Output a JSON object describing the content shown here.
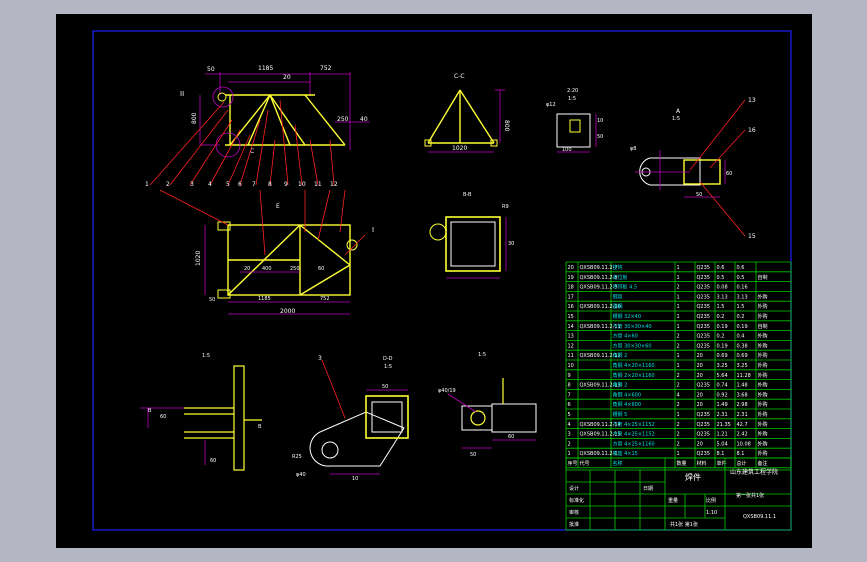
{
  "colors": {
    "background": "#b4b7c3",
    "sheet": "#000000",
    "frame": "#1b1bd6",
    "part": "#ffff33",
    "dim": "#c000c0",
    "leader": "#ff2020",
    "table": "#00cc00",
    "text": "#ffffff",
    "cyan": "#00e0e0"
  },
  "views": {
    "front": {
      "top_dims": [
        "50",
        "1185",
        "752"
      ],
      "mid_dims": [
        "20",
        "20"
      ],
      "left_dim": "800",
      "right_dims": [
        "250",
        "40"
      ],
      "section_mark": "C",
      "callout": "II",
      "leader_numbers": [
        "1",
        "2",
        "3",
        "4",
        "5",
        "6",
        "7",
        "8",
        "9",
        "10",
        "11",
        "12"
      ]
    },
    "section_cc": {
      "title": "C-C",
      "height_dim": "800",
      "base_dim": "1020"
    },
    "detail_small": {
      "scale_top": "2:20",
      "scale_bot": "1:5",
      "dim_a": "φ12",
      "dim_b": "100",
      "dim_c": "10",
      "dim_d": "50"
    },
    "detail_a": {
      "title": "A",
      "scale": "1:5",
      "dims": [
        "φ8",
        "50",
        "60"
      ],
      "leader_numbers": [
        "13",
        "16",
        "15"
      ]
    },
    "plan": {
      "mark": "E",
      "dims_inner": [
        "20",
        "400",
        "250",
        "60"
      ],
      "left_dim": "1020",
      "bottom_dims": [
        "50",
        "1185",
        "752"
      ],
      "total": "2000",
      "callout": "I"
    },
    "section_bb": {
      "title": "B-B",
      "dims": [
        "R9",
        "30"
      ]
    },
    "section_a": {
      "title": "1:5",
      "labels": [
        "B",
        "B"
      ],
      "dims": [
        "60",
        "60"
      ]
    },
    "section_dd": {
      "title": "D-D",
      "scale": "1:5",
      "leader": "3",
      "dims": [
        "50",
        "φ40",
        "R25",
        "10"
      ]
    },
    "detail_b": {
      "title": "1:5",
      "dims": [
        "φ40/19",
        "50",
        "60"
      ]
    }
  },
  "bom": {
    "rows": [
      [
        "20",
        "QXSB09.11.2-7",
        "挂钩",
        "1",
        "Q235",
        "0.6",
        "0.6",
        ""
      ],
      [
        "19",
        "QXSB09.11.2-8",
        "定位板",
        "1",
        "Q235",
        "0.5",
        "0.5",
        "自制"
      ],
      [
        "18",
        "QXSB09.11.2-9",
        "吊耳板 4.5",
        "2",
        "Q235",
        "0.08",
        "0.16",
        ""
      ],
      [
        "17",
        "",
        "钢管",
        "1",
        "Q235",
        "3.13",
        "3.13",
        "外购"
      ],
      [
        "16",
        "QXSB09.11.2-10",
        "圆钢",
        "1",
        "Q235",
        "1.5",
        "1.5",
        "外购"
      ],
      [
        "15",
        "",
        "槽钢 32×40",
        "1",
        "Q235",
        "0.2",
        "0.2",
        "外购"
      ],
      [
        "14",
        "QXSB09.11.2-11",
        "方管 30×30×40",
        "1",
        "Q235",
        "0.19",
        "0.19",
        "自制"
      ],
      [
        "13",
        "",
        "方管 4×60",
        "2",
        "Q235",
        "0.2",
        "0.4",
        "外购"
      ],
      [
        "12",
        "",
        "方管 30×30×60",
        "2",
        "Q235",
        "0.19",
        "0.38",
        "外购"
      ],
      [
        "11",
        "QXSB09.11.2-12",
        "角钢 2",
        "1",
        "20",
        "0.69",
        "0.69",
        "外购"
      ],
      [
        "10",
        "",
        "角钢 4×20×1160",
        "1",
        "20",
        "3.25",
        "3.25",
        "外购"
      ],
      [
        "9",
        "",
        "角钢 2×20×1160",
        "2",
        "20",
        "5.64",
        "11.28",
        "外购"
      ],
      [
        "8",
        "QXSB09.11.2-13",
        "角钢 2",
        "2",
        "Q235",
        "0.74",
        "1.48",
        "外购"
      ],
      [
        "7",
        "",
        "角钢 4×600",
        "4",
        "20",
        "0.92",
        "3.68",
        "外购"
      ],
      [
        "6",
        "",
        "角钢 4×600",
        "2",
        "20",
        "1.49",
        "2.98",
        "外购"
      ],
      [
        "5",
        "",
        "槽钢 5",
        "1",
        "Q235",
        "2.31",
        "2.31",
        "外购"
      ],
      [
        "4",
        "QXSB09.11.2-14",
        "方管 4×25×1152",
        "2",
        "Q235",
        "21.35",
        "42.7",
        "外购"
      ],
      [
        "3",
        "QXSB09.11.2-15",
        "方管 4×25×1152",
        "2",
        "Q235",
        "1.21",
        "2.42",
        "外购"
      ],
      [
        "2",
        "",
        "方管 4×25×1160",
        "2",
        "20",
        "5.04",
        "10.08",
        "外购"
      ],
      [
        "1",
        "QXSB09.11.2-1",
        "底座 4×15",
        "1",
        "Q235",
        "8.1",
        "8.1",
        "外购"
      ]
    ],
    "header": [
      "序号",
      "代号",
      "名称",
      "数量",
      "材料",
      "单件",
      "总计",
      "备注"
    ],
    "title_block": {
      "part_name": "焊件",
      "company": "山东建筑工程学院",
      "drawing_no": "QXSB09.11.1",
      "scale_label": "比例",
      "scale": "1:10",
      "sheet": "第一张共1张",
      "weight_label": "重量",
      "designer": "设计",
      "checker": "审核",
      "approve": "批准",
      "std": "标准化",
      "date": "日期",
      "qty_label": "共1张 第1张"
    }
  }
}
